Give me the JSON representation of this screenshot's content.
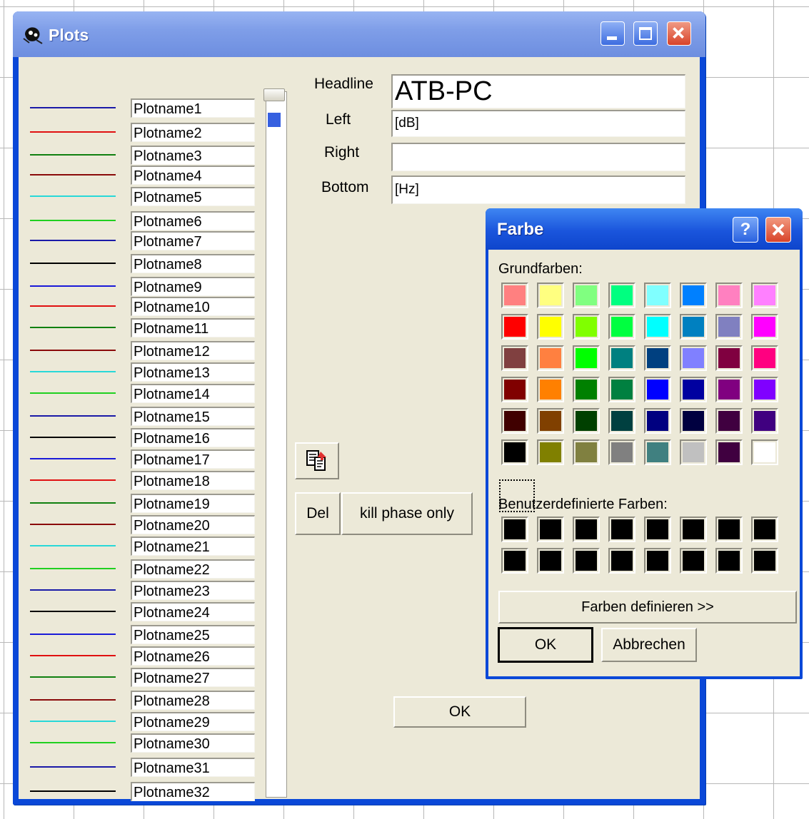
{
  "plots_window": {
    "title": "Plots",
    "plot_lines": [
      {
        "name": "Plotname1",
        "color": "#1a1aa8"
      },
      {
        "name": "Plotname2",
        "color": "#e01010"
      },
      {
        "name": "Plotname3",
        "color": "#108010"
      },
      {
        "name": "Plotname4",
        "color": "#8a0a0a"
      },
      {
        "name": "Plotname5",
        "color": "#28d8d8"
      },
      {
        "name": "Plotname6",
        "color": "#20d020"
      },
      {
        "name": "Plotname7",
        "color": "#1a1aa8"
      },
      {
        "name": "Plotname8",
        "color": "#000000"
      },
      {
        "name": "Plotname9",
        "color": "#1a1ad8"
      },
      {
        "name": "Plotname10",
        "color": "#e01010"
      },
      {
        "name": "Plotname11",
        "color": "#108010"
      },
      {
        "name": "Plotname12",
        "color": "#8a0a0a"
      },
      {
        "name": "Plotname13",
        "color": "#28d8d8"
      },
      {
        "name": "Plotname14",
        "color": "#20d020"
      },
      {
        "name": "Plotname15",
        "color": "#1a1aa8"
      },
      {
        "name": "Plotname16",
        "color": "#000000"
      },
      {
        "name": "Plotname17",
        "color": "#1a1ad8"
      },
      {
        "name": "Plotname18",
        "color": "#e01010"
      },
      {
        "name": "Plotname19",
        "color": "#108010"
      },
      {
        "name": "Plotname20",
        "color": "#8a0a0a"
      },
      {
        "name": "Plotname21",
        "color": "#28d8d8"
      },
      {
        "name": "Plotname22",
        "color": "#20d020"
      },
      {
        "name": "Plotname23",
        "color": "#1a1aa8"
      },
      {
        "name": "Plotname24",
        "color": "#000000"
      },
      {
        "name": "Plotname25",
        "color": "#1a1ad8"
      },
      {
        "name": "Plotname26",
        "color": "#e01010"
      },
      {
        "name": "Plotname27",
        "color": "#108010"
      },
      {
        "name": "Plotname28",
        "color": "#8a0a0a"
      },
      {
        "name": "Plotname29",
        "color": "#28d8d8"
      },
      {
        "name": "Plotname30",
        "color": "#20d020"
      },
      {
        "name": "Plotname31",
        "color": "#1a1aa8"
      },
      {
        "name": "Plotname32",
        "color": "#000000"
      }
    ],
    "headline_label": "Headline",
    "headline_value": "ATB-PC",
    "left_label": "Left",
    "left_value": "[dB]",
    "right_label": "Right",
    "right_value": "",
    "bottom_label": "Bottom",
    "bottom_value": "[Hz]",
    "del_label": "Del",
    "kill_phase_label": "kill phase only",
    "ok_label": "OK"
  },
  "farbe_dialog": {
    "title": "Farbe",
    "help_label": "?",
    "grundfarben_label": "Grundfarben:",
    "basic_colors": [
      "#ff8080",
      "#ffff80",
      "#80ff80",
      "#00ff80",
      "#80ffff",
      "#0080ff",
      "#ff80c0",
      "#ff80ff",
      "#ff0000",
      "#ffff00",
      "#80ff00",
      "#00ff40",
      "#00ffff",
      "#0080c0",
      "#8080c0",
      "#ff00ff",
      "#804040",
      "#ff8040",
      "#00ff00",
      "#008080",
      "#004080",
      "#8080ff",
      "#800040",
      "#ff0080",
      "#800000",
      "#ff8000",
      "#008000",
      "#008040",
      "#0000ff",
      "#0000a0",
      "#800080",
      "#8000ff",
      "#400000",
      "#804000",
      "#004000",
      "#004040",
      "#000080",
      "#000040",
      "#400040",
      "#400080",
      "#000000",
      "#808000",
      "#808040",
      "#808080",
      "#408080",
      "#c0c0c0",
      "#400040",
      "#ffffff"
    ],
    "custom_label": "Benutzerdefinierte Farben:",
    "custom_colors": [
      "#000000",
      "#000000",
      "#000000",
      "#000000",
      "#000000",
      "#000000",
      "#000000",
      "#000000",
      "#000000",
      "#000000",
      "#000000",
      "#000000",
      "#000000",
      "#000000",
      "#000000",
      "#000000"
    ],
    "define_label": "Farben definieren >>",
    "ok_label": "OK",
    "cancel_label": "Abbrechen"
  }
}
